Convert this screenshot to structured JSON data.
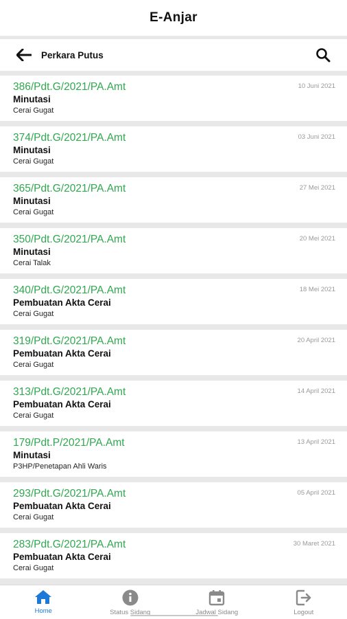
{
  "app": {
    "title": "E-Anjar"
  },
  "toolbar": {
    "screen_title": "Perkara Putus",
    "back_icon": "arrow-left-icon",
    "search_icon": "search-icon"
  },
  "cases": [
    {
      "number": "386/Pdt.G/2021/PA.Amt",
      "stage": "Minutasi",
      "type": "Cerai Gugat",
      "date": "10 Juni 2021"
    },
    {
      "number": "374/Pdt.G/2021/PA.Amt",
      "stage": "Minutasi",
      "type": "Cerai Gugat",
      "date": "03 Juni 2021"
    },
    {
      "number": "365/Pdt.G/2021/PA.Amt",
      "stage": "Minutasi",
      "type": "Cerai Gugat",
      "date": "27 Mei 2021"
    },
    {
      "number": "350/Pdt.G/2021/PA.Amt",
      "stage": "Minutasi",
      "type": "Cerai Talak",
      "date": "20 Mei 2021"
    },
    {
      "number": "340/Pdt.G/2021/PA.Amt",
      "stage": "Pembuatan Akta Cerai",
      "type": "Cerai Gugat",
      "date": "18 Mei 2021"
    },
    {
      "number": "319/Pdt.G/2021/PA.Amt",
      "stage": "Pembuatan Akta Cerai",
      "type": "Cerai Gugat",
      "date": "20 April 2021"
    },
    {
      "number": "313/Pdt.G/2021/PA.Amt",
      "stage": "Pembuatan Akta Cerai",
      "type": "Cerai Gugat",
      "date": "14 April 2021"
    },
    {
      "number": "179/Pdt.P/2021/PA.Amt",
      "stage": "Minutasi",
      "type": "P3HP/Penetapan Ahli Waris",
      "date": "13 April 2021"
    },
    {
      "number": "293/Pdt.G/2021/PA.Amt",
      "stage": "Pembuatan Akta Cerai",
      "type": "Cerai Gugat",
      "date": "05 April 2021"
    },
    {
      "number": "283/Pdt.G/2021/PA.Amt",
      "stage": "Pembuatan Akta Cerai",
      "type": "Cerai Gugat",
      "date": "30 Maret 2021"
    }
  ],
  "nav": {
    "items": [
      {
        "label": "Home",
        "icon": "home-icon",
        "active": true
      },
      {
        "label": "Status Sidang",
        "icon": "info-icon",
        "active": false
      },
      {
        "label": "Jadwal Sidang",
        "icon": "calendar-icon",
        "active": false
      },
      {
        "label": "Logout",
        "icon": "logout-icon",
        "active": false
      }
    ]
  },
  "colors": {
    "accent": "#2fa84f",
    "nav_active": "#1e78d8",
    "nav_inactive": "#8a8a8a",
    "background": "#e8e8e8"
  }
}
